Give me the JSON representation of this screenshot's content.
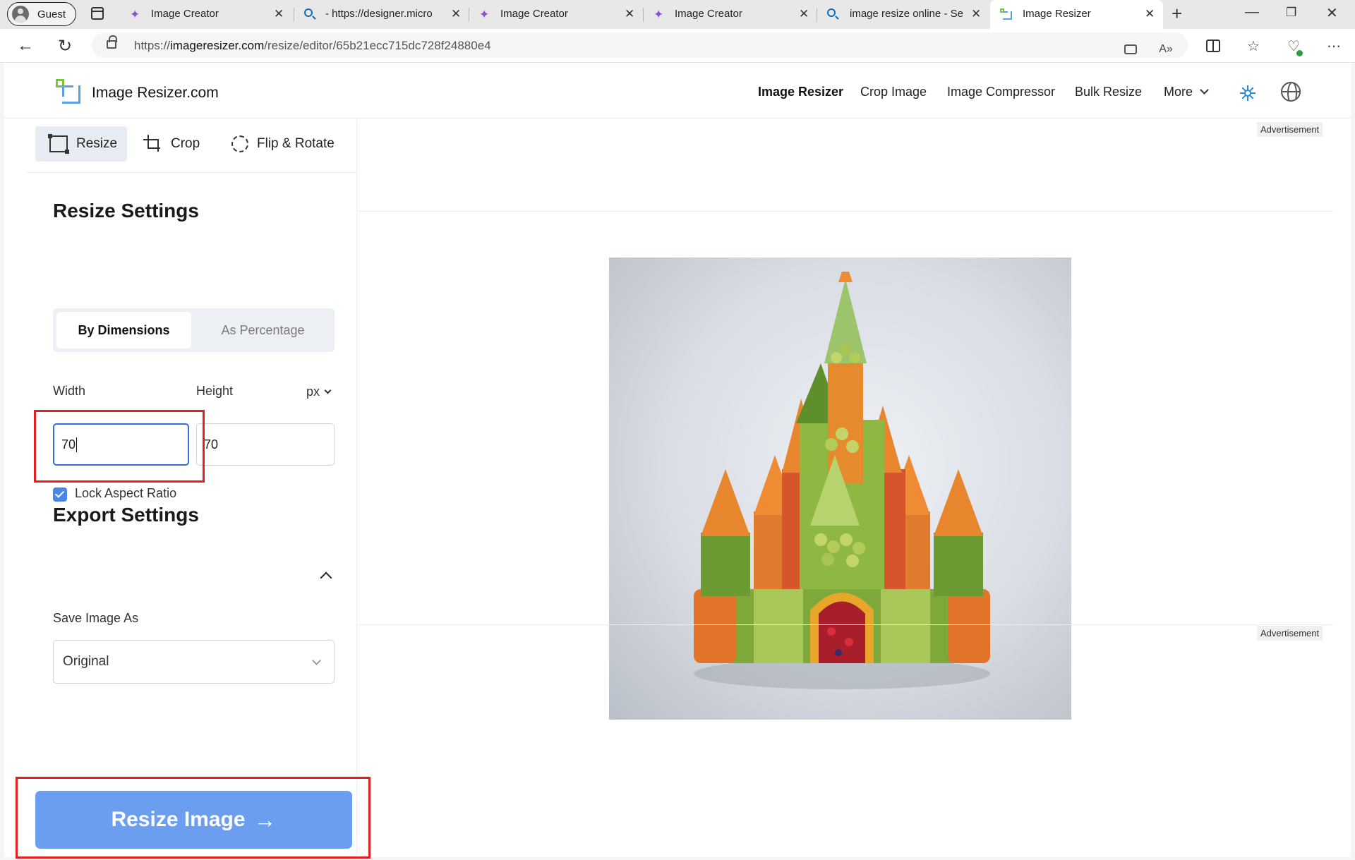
{
  "browser": {
    "profile_label": "Guest",
    "tabs": [
      {
        "title": "Image Creator",
        "favicon": "sparkle-icon"
      },
      {
        "title": "- https://designer.micro",
        "favicon": "search-icon"
      },
      {
        "title": "Image Creator",
        "favicon": "sparkle-icon"
      },
      {
        "title": "Image Creator",
        "favicon": "sparkle-icon"
      },
      {
        "title": "image resize online - Se",
        "favicon": "search-icon"
      },
      {
        "title": "Image Resizer",
        "favicon": "image-resizer-icon",
        "active": true
      }
    ],
    "url_prefix": "https://",
    "url_host": "imageresizer.com",
    "url_path": "/resize/editor/65b21ecc715dc728f24880e4"
  },
  "site": {
    "brand": "Image Resizer.com",
    "nav": [
      "Image Resizer",
      "Crop Image",
      "Image Compressor",
      "Bulk Resize",
      "More"
    ],
    "accent": "#6c9ef0"
  },
  "tools": {
    "resize": "Resize",
    "crop": "Crop",
    "flip_rotate": "Flip & Rotate"
  },
  "resize_settings": {
    "heading": "Resize Settings",
    "mode_dimensions": "By Dimensions",
    "mode_percentage": "As Percentage",
    "width_label": "Width",
    "height_label": "Height",
    "unit": "px",
    "width_value": "70",
    "height_value": "70",
    "lock_label": "Lock Aspect Ratio",
    "lock_checked": true
  },
  "export_settings": {
    "heading": "Export Settings",
    "save_as_label": "Save Image As",
    "save_as_value": "Original"
  },
  "action": {
    "resize_button": "Resize Image",
    "arrow": "→"
  },
  "ads": {
    "top": "Advertisement",
    "bottom": "Advertisement"
  },
  "preview": {
    "description_icon": "fruit-castle-image"
  }
}
